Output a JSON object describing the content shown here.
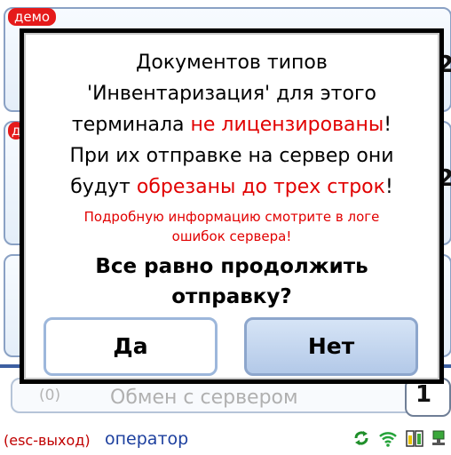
{
  "background": {
    "demo_badge_1": "демо",
    "demo_badge_2": "д",
    "tile_num_1": "2",
    "tile_num_2": "2",
    "exchange_count": "(0)",
    "exchange_label": "Обмен с сервером",
    "exchange_side": "1"
  },
  "dialog": {
    "line1": "Документов типов",
    "line2": "'Инвентаризация' для этого",
    "line3_prefix": "терминала ",
    "line3_red": "не лицензированы",
    "line3_suffix": "!",
    "line4": "При их отправке на сервер они",
    "line5_prefix": "будут ",
    "line5_red": "обрезаны до трех строк",
    "line5_suffix": "!",
    "note_line1": "Подробную информацию смотрите в логе",
    "note_line2": "ошибок сервера!",
    "question_line1": "Все равно продолжить",
    "question_line2": "отправку?",
    "yes_label": "Да",
    "no_label": "Нет"
  },
  "status_bar": {
    "esc_label": "(esc-выход)",
    "operator_label": "оператор",
    "icons": [
      "sync-icon",
      "wifi-icon",
      "battery-icon",
      "network-icon"
    ]
  },
  "colors": {
    "accent_red": "#e10000",
    "operator_blue": "#1c3f9e",
    "tile_border": "#8aa1c4"
  }
}
